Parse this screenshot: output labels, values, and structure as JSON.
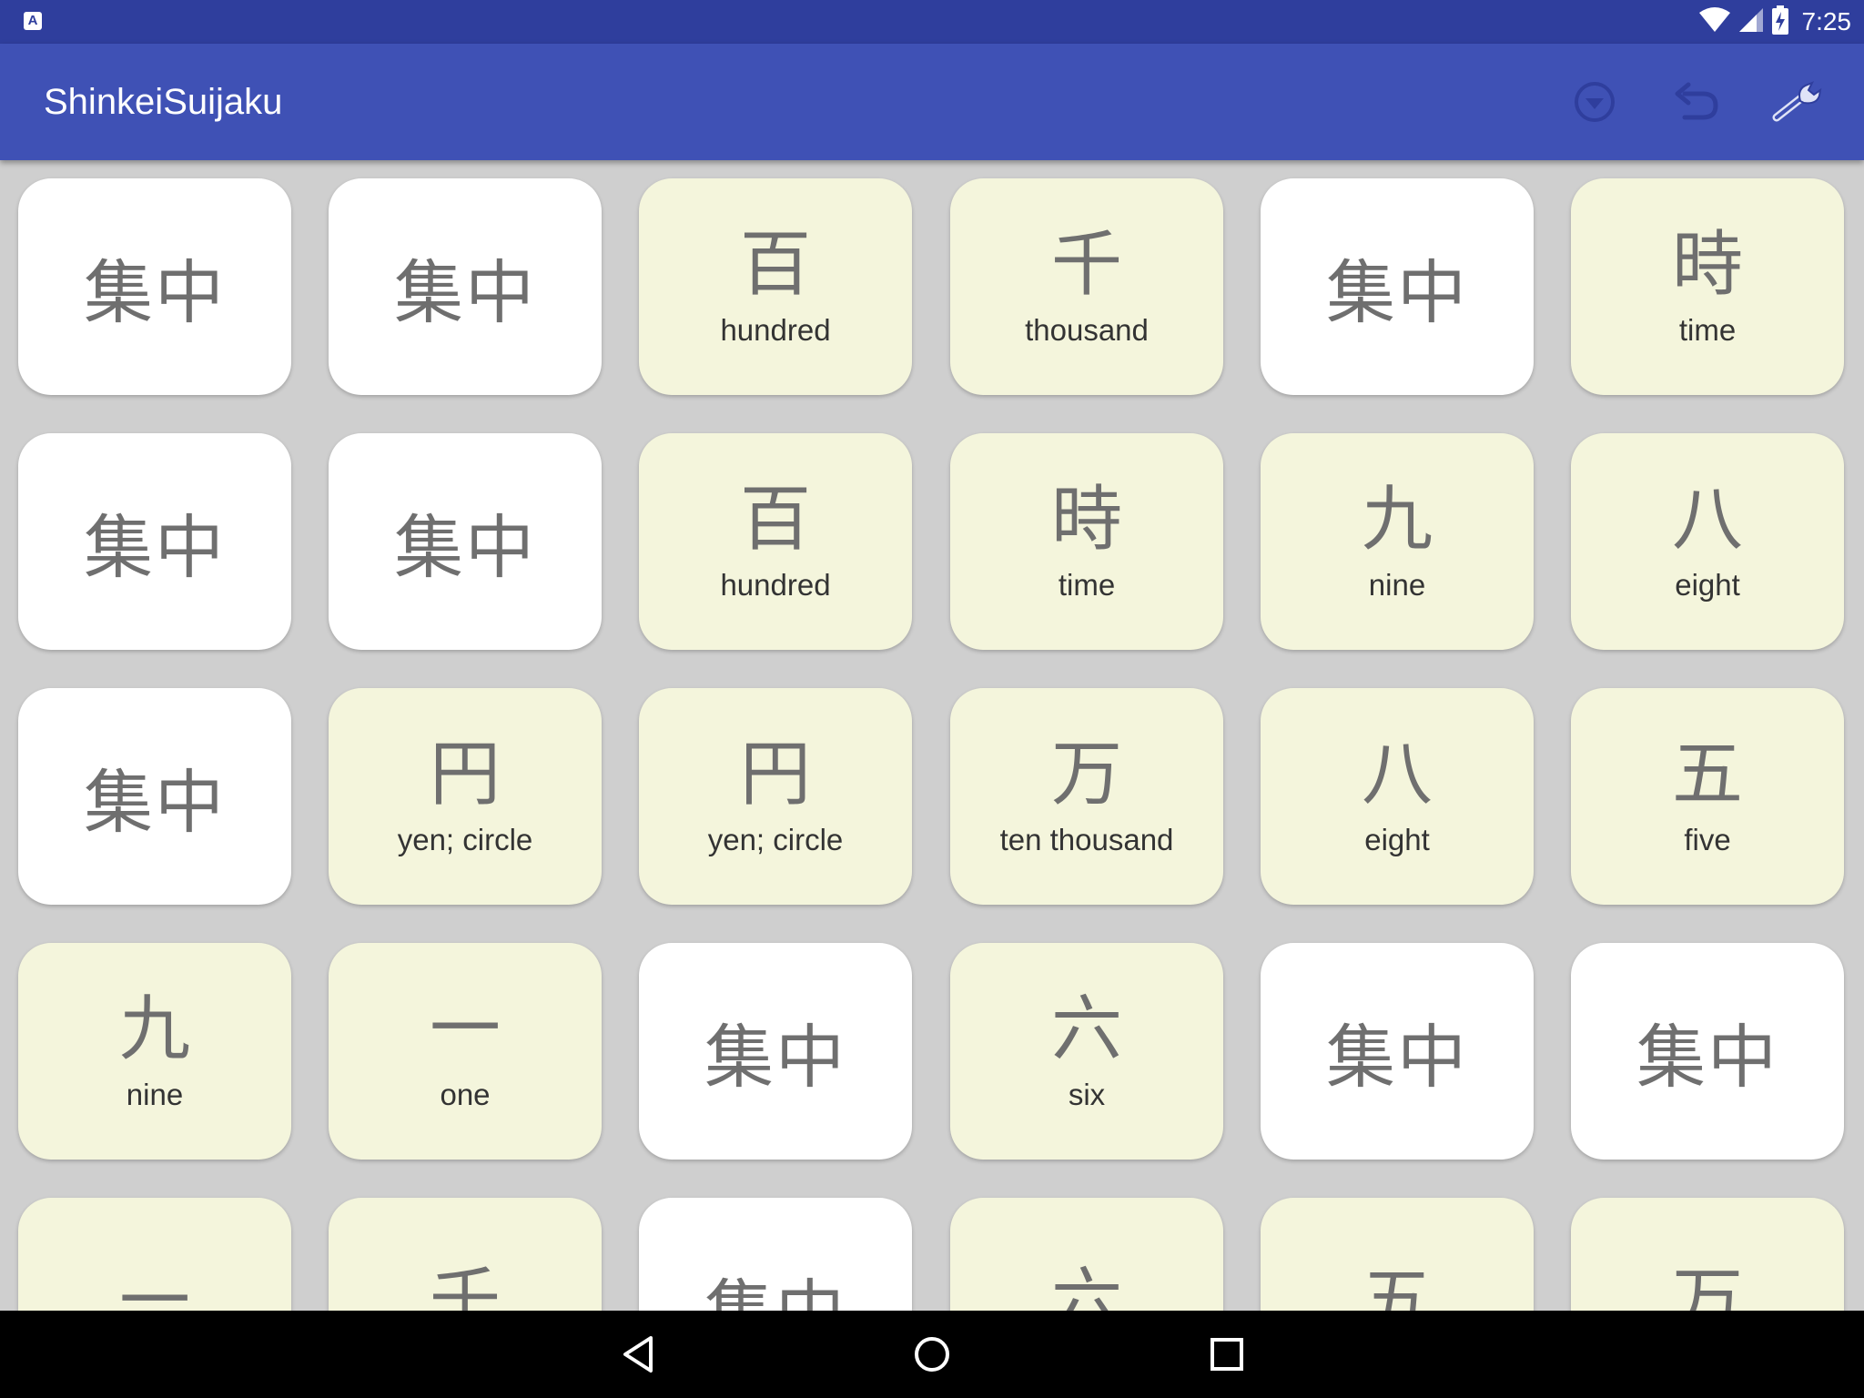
{
  "status": {
    "time": "7:25",
    "notification_icon": "a-app-icon",
    "icons": [
      "wifi-icon",
      "signal-icon",
      "battery-charging-icon"
    ]
  },
  "app": {
    "title": "ShinkeiSuijaku",
    "actions": [
      {
        "name": "dropdown-circle-icon",
        "label": "menu"
      },
      {
        "name": "undo-icon",
        "label": "undo"
      },
      {
        "name": "wrench-icon",
        "label": "settings"
      }
    ]
  },
  "cards": {
    "back_text": "集中",
    "colors": {
      "back": "#ffffff",
      "face": "#f4f5dc",
      "accent": "#3f51b5"
    },
    "rows": [
      [
        {
          "state": "back"
        },
        {
          "state": "back"
        },
        {
          "state": "face",
          "kanji": "百",
          "meaning": "hundred"
        },
        {
          "state": "face",
          "kanji": "千",
          "meaning": "thousand"
        },
        {
          "state": "back"
        },
        {
          "state": "face",
          "kanji": "時",
          "meaning": "time"
        }
      ],
      [
        {
          "state": "back"
        },
        {
          "state": "back"
        },
        {
          "state": "face",
          "kanji": "百",
          "meaning": "hundred"
        },
        {
          "state": "face",
          "kanji": "時",
          "meaning": "time"
        },
        {
          "state": "face",
          "kanji": "九",
          "meaning": "nine"
        },
        {
          "state": "face",
          "kanji": "八",
          "meaning": "eight"
        }
      ],
      [
        {
          "state": "back"
        },
        {
          "state": "face",
          "kanji": "円",
          "meaning": "yen; circle"
        },
        {
          "state": "face",
          "kanji": "円",
          "meaning": "yen; circle"
        },
        {
          "state": "face",
          "kanji": "万",
          "meaning": "ten thousand"
        },
        {
          "state": "face",
          "kanji": "八",
          "meaning": "eight"
        },
        {
          "state": "face",
          "kanji": "五",
          "meaning": "five"
        }
      ],
      [
        {
          "state": "face",
          "kanji": "九",
          "meaning": "nine"
        },
        {
          "state": "face",
          "kanji": "一",
          "meaning": "one"
        },
        {
          "state": "back"
        },
        {
          "state": "face",
          "kanji": "六",
          "meaning": "six"
        },
        {
          "state": "back"
        },
        {
          "state": "back"
        }
      ],
      [
        {
          "state": "face",
          "kanji": "一",
          "meaning": ""
        },
        {
          "state": "face",
          "kanji": "千",
          "meaning": ""
        },
        {
          "state": "back"
        },
        {
          "state": "face",
          "kanji": "六",
          "meaning": ""
        },
        {
          "state": "face",
          "kanji": "五",
          "meaning": ""
        },
        {
          "state": "face",
          "kanji": "万",
          "meaning": ""
        }
      ]
    ]
  },
  "nav": [
    "back-icon",
    "home-icon",
    "recents-icon"
  ]
}
